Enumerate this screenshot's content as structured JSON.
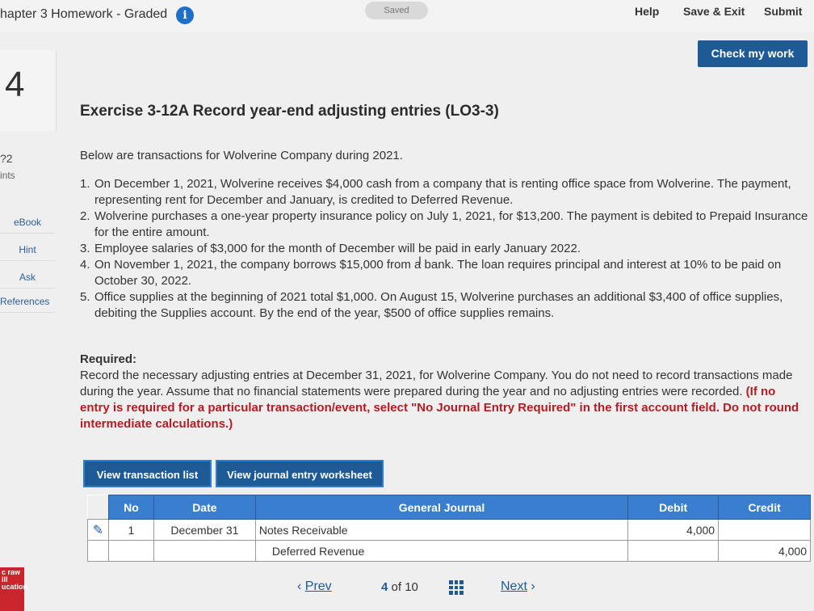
{
  "header": {
    "title": "hapter 3 Homework - Graded",
    "saved_label": "Saved",
    "help_label": "Help",
    "save_exit_label": "Save & Exit",
    "submit_label": "Submit",
    "check_work_label": "Check my work"
  },
  "sidebar": {
    "question_number": "4",
    "points_value": "?2",
    "points_label": "ints",
    "links": [
      "eBook",
      "Hint",
      "Ask",
      "References"
    ]
  },
  "exercise": {
    "title": "Exercise 3-12A Record year-end adjusting entries (LO3-3)",
    "intro": "Below are transactions for Wolverine Company during 2021.",
    "transactions": [
      {
        "num": "1.",
        "text": "On December 1, 2021, Wolverine receives $4,000 cash from a company that is renting office space from Wolverine. The payment, representing rent for December and January, is credited to Deferred Revenue."
      },
      {
        "num": "2.",
        "text": "Wolverine purchases a one-year property insurance policy on July 1, 2021, for $13,200. The payment is debited to Prepaid Insurance for the entire amount."
      },
      {
        "num": "3.",
        "text": "Employee salaries of $3,000 for the month of December will be paid in early January 2022."
      },
      {
        "num": "4.",
        "text": "On November 1, 2021, the company borrows $15,000 from a bank. The loan requires principal and interest at 10% to be paid on October 30, 2022."
      },
      {
        "num": "5.",
        "text": "Office supplies at the beginning of 2021 total $1,000. On August 15, Wolverine purchases an additional $3,400 of office supplies, debiting the Supplies account. By the end of the year, $500 of office supplies remains."
      }
    ],
    "required_heading": "Required:",
    "required_text": "Record the necessary adjusting entries at December 31, 2021, for Wolverine Company. You do not need to record transactions made during the year. Assume that no financial statements were prepared during the year and no adjusting entries were recorded.",
    "required_note": "(If no entry is required for a particular transaction/event, select \"No Journal Entry Required\" in the first account field. Do not round intermediate calculations.)"
  },
  "tabs": {
    "transaction_list": "View transaction list",
    "journal_worksheet": "View journal entry worksheet"
  },
  "journal": {
    "headers": [
      "No",
      "Date",
      "General Journal",
      "Debit",
      "Credit"
    ],
    "rows": [
      {
        "no": "1",
        "date": "December 31",
        "account": "Notes Receivable",
        "debit": "4,000",
        "credit": ""
      },
      {
        "no": "",
        "date": "",
        "account": "Deferred Revenue",
        "debit": "",
        "credit": "4,000"
      }
    ]
  },
  "footer": {
    "prev_label": "Prev",
    "page_current": "4",
    "page_of": "of 10",
    "next_label": "Next",
    "logo_text": "c raw ill ucation"
  }
}
